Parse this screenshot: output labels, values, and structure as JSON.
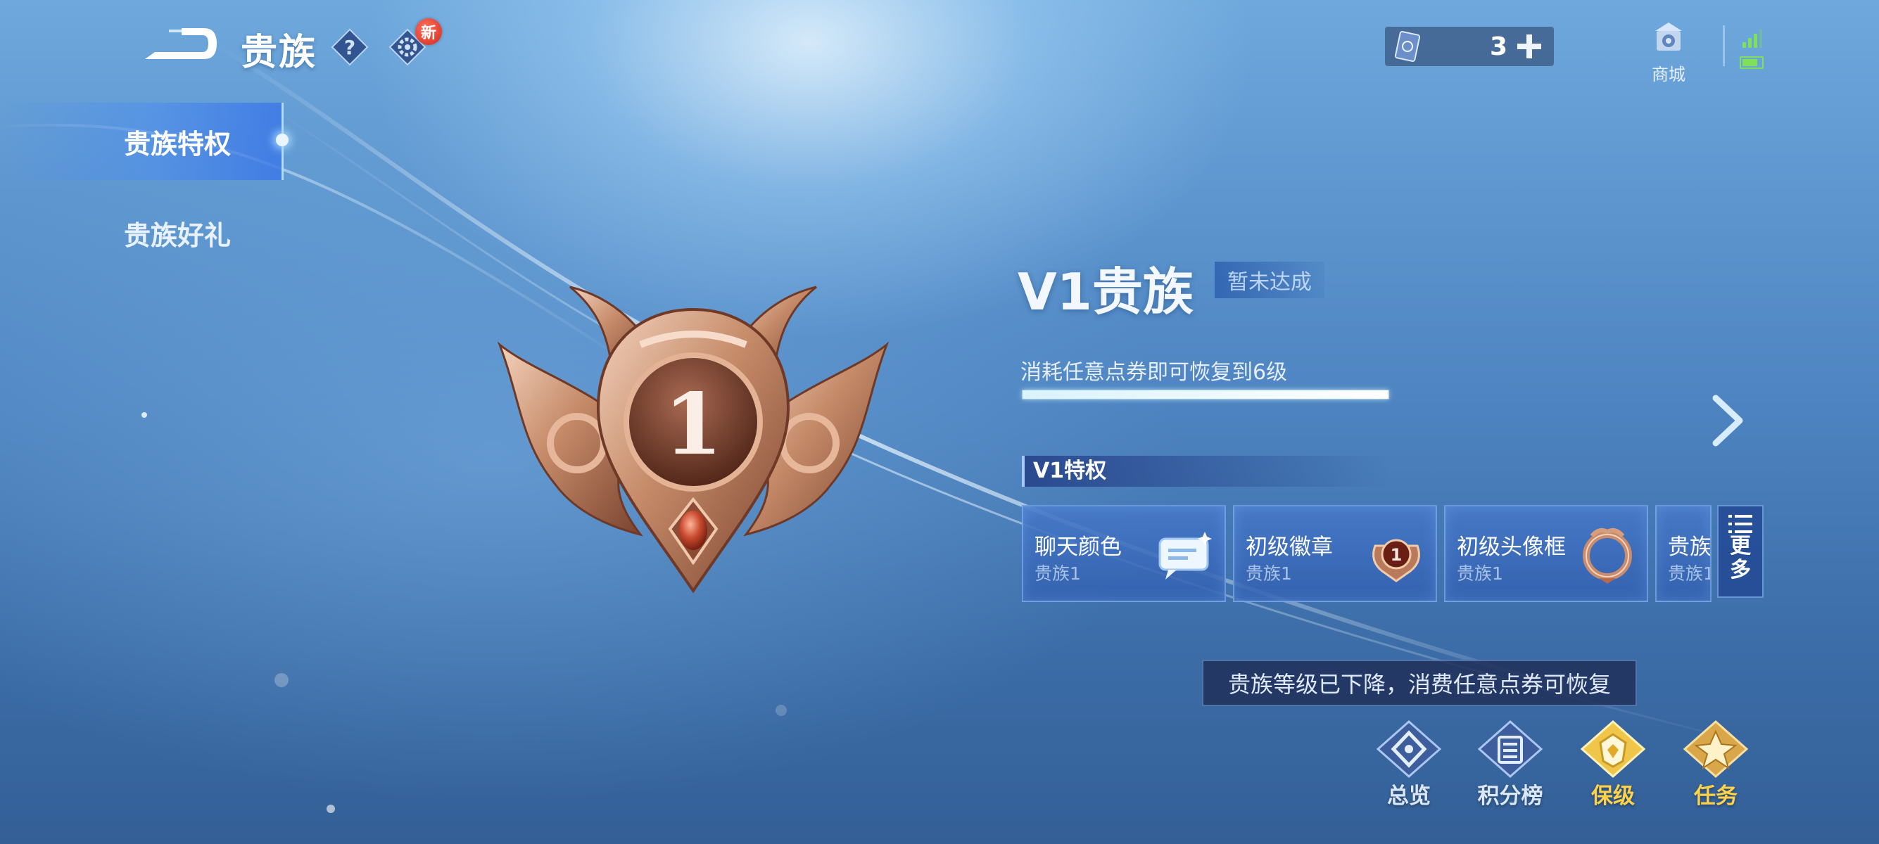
{
  "header": {
    "title": "贵族",
    "new_badge": "新",
    "currency_count": "3",
    "shop_label": "商城"
  },
  "sidebar": {
    "items": [
      {
        "label": "贵族特权",
        "active": true
      },
      {
        "label": "贵族好礼",
        "active": false
      }
    ]
  },
  "emblem": {
    "level_number": "1"
  },
  "info": {
    "title": "V1贵族",
    "status": "暂未达成",
    "hint": "消耗任意点券即可恢复到6级",
    "progress_fraction": 1.0
  },
  "privileges": {
    "header": "V1特权",
    "cards": [
      {
        "name": "聊天颜色",
        "sub": "贵族1",
        "icon": "chat-bubble-icon"
      },
      {
        "name": "初级徽章",
        "sub": "贵族1",
        "icon": "badge-icon"
      },
      {
        "name": "初级头像框",
        "sub": "贵族1",
        "icon": "avatar-frame-icon"
      },
      {
        "name": "贵族",
        "sub": "贵族1",
        "icon": ""
      }
    ],
    "more_label": [
      "更",
      "多"
    ]
  },
  "tooltip": "贵族等级已下降，消费任意点券可恢复",
  "bottom_nav": [
    {
      "label": "总览",
      "icon": "overview-icon"
    },
    {
      "label": "积分榜",
      "icon": "leaderboard-icon"
    },
    {
      "label": "保级",
      "icon": "keep-level-icon"
    },
    {
      "label": "任务",
      "icon": "tasks-icon"
    }
  ],
  "colors": {
    "accent_gold": "#ffd24a",
    "bronze": "#b9785a",
    "panel_blue": "#3a6fc0"
  }
}
